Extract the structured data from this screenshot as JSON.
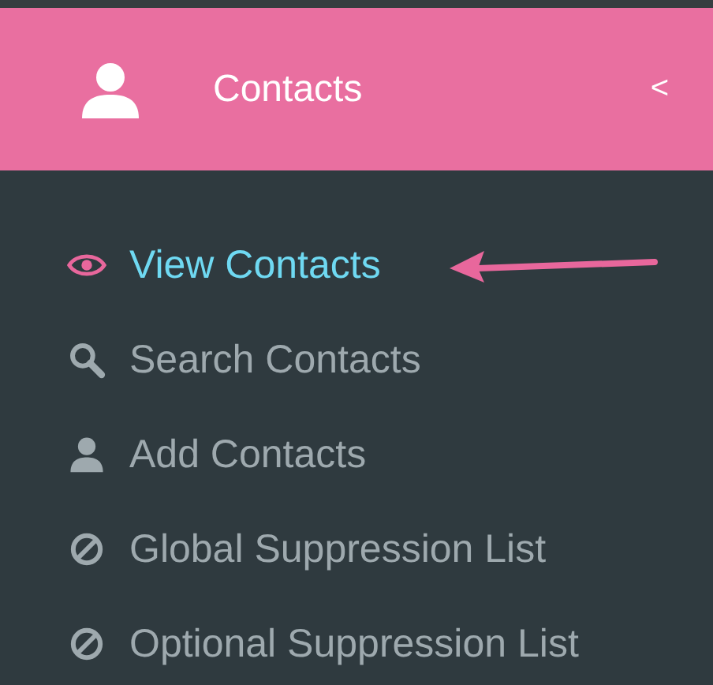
{
  "header": {
    "title": "Contacts",
    "collapse": "<"
  },
  "menu": [
    {
      "label": "View Contacts",
      "kind": "view",
      "selected": true
    },
    {
      "label": "Search Contacts",
      "kind": "search",
      "selected": false
    },
    {
      "label": "Add Contacts",
      "kind": "add",
      "selected": false
    },
    {
      "label": "Global Suppression List",
      "kind": "suppression",
      "selected": false
    },
    {
      "label": "Optional Suppression List",
      "kind": "suppression",
      "selected": false
    }
  ],
  "annotation": {
    "kind": "arrow"
  }
}
